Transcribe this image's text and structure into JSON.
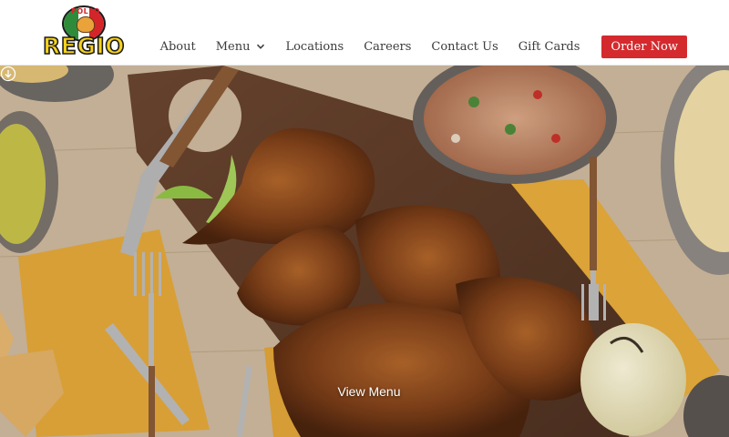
{
  "logo": {
    "top_text": "POLLO",
    "main_text": "REGIO"
  },
  "nav": {
    "about": "About",
    "menu": "Menu",
    "locations": "Locations",
    "careers": "Careers",
    "contact": "Contact Us",
    "gift_cards": "Gift Cards",
    "order_now": "Order Now"
  },
  "hero": {
    "cta_label": "View Menu",
    "cta_icon": "chevron-down-circle-icon"
  },
  "colors": {
    "order_button": "#d42a2e",
    "logo_yellow": "#f6d21c",
    "nav_text": "#3b3b3b"
  }
}
